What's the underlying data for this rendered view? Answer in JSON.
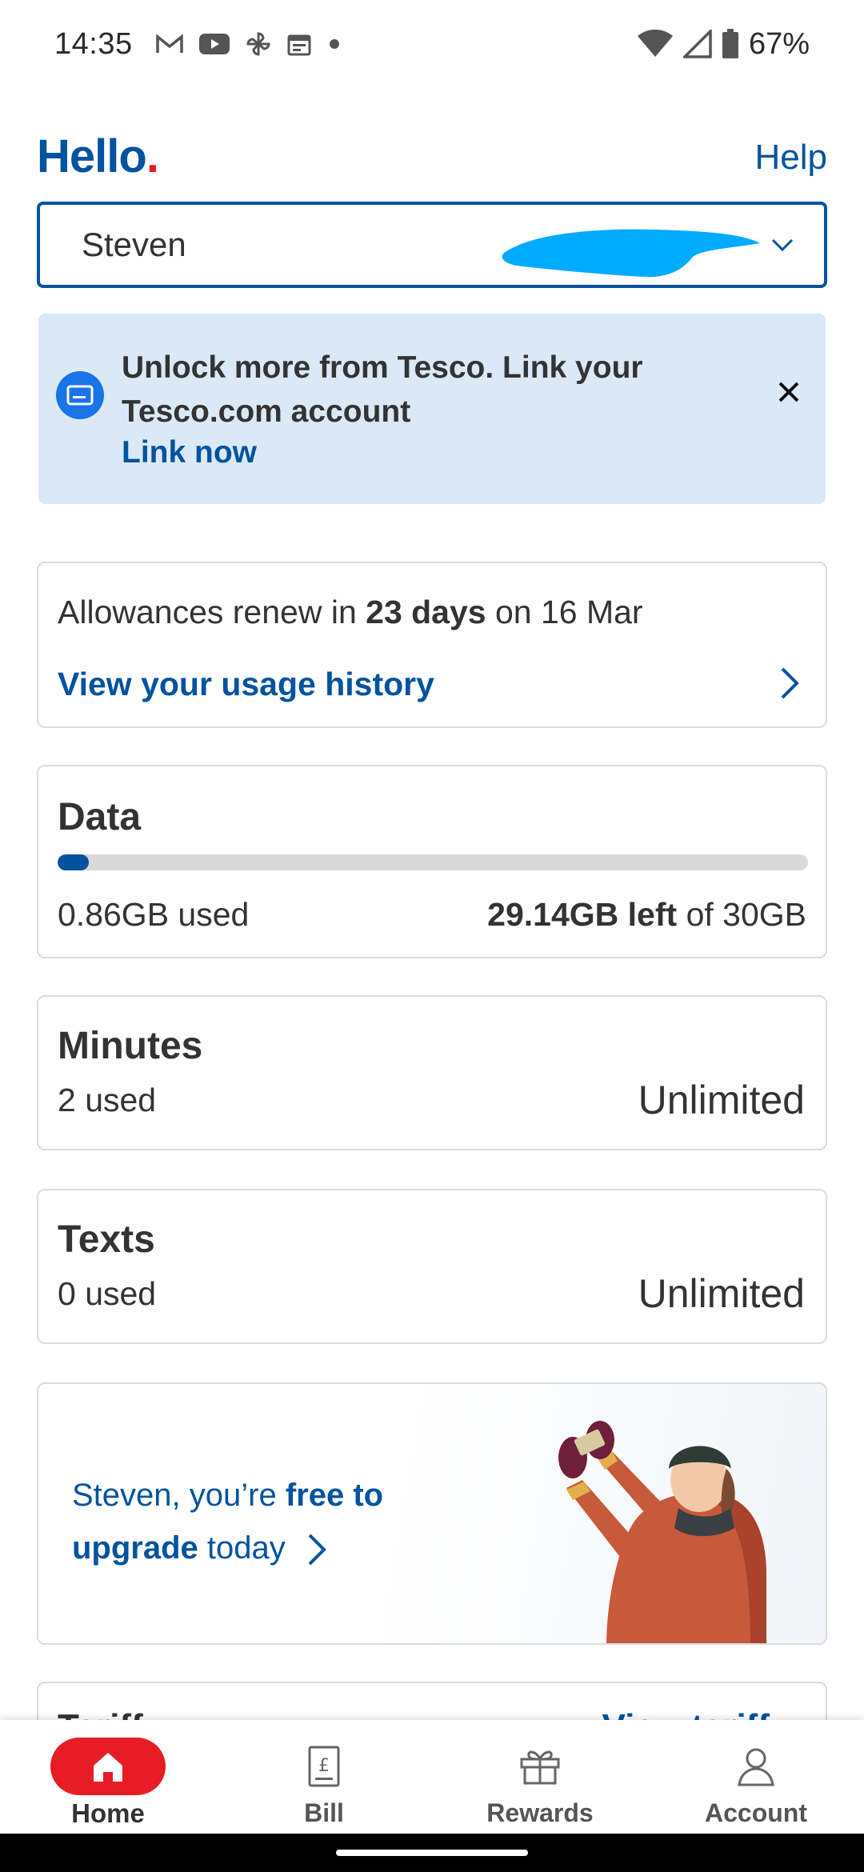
{
  "status_bar": {
    "time": "14:35",
    "battery": "67%",
    "icons": [
      "gmail-icon",
      "youtube-icon",
      "pinwheel-icon",
      "calendar-icon",
      "dot-icon",
      "wifi-icon",
      "signal-icon",
      "battery-icon"
    ]
  },
  "header": {
    "greeting": "Hello",
    "greeting_dot": ".",
    "help": "Help"
  },
  "account_select": {
    "name": "Steven",
    "icon": "chevron-down-icon"
  },
  "banner": {
    "text": "Unlock more from Tesco. Link your Tesco.com account",
    "link": "Link now",
    "icons": [
      "card-icon",
      "close-icon"
    ]
  },
  "renew": {
    "prefix": "Allowances renew in ",
    "days": "23 days",
    "suffix": " on 16 Mar",
    "usage_link": "View your usage history"
  },
  "data": {
    "title": "Data",
    "used": "0.86GB used",
    "left_value": "29.14GB left",
    "left_suffix": " of 30GB",
    "used_fraction": 0.0287
  },
  "minutes": {
    "title": "Minutes",
    "used": "2 used",
    "allowance": "Unlimited"
  },
  "texts": {
    "title": "Texts",
    "used": "0 used",
    "allowance": "Unlimited"
  },
  "promo": {
    "prefix": "Steven, you’re ",
    "bold": "free to upgrade",
    "suffix": " today"
  },
  "tariff": {
    "title": "Tariff",
    "link": "View tariff"
  },
  "bottom_nav": {
    "items": [
      {
        "label": "Home",
        "icon": "home-icon",
        "active": true
      },
      {
        "label": "Bill",
        "icon": "bill-icon",
        "active": false
      },
      {
        "label": "Rewards",
        "icon": "gift-icon",
        "active": false
      },
      {
        "label": "Account",
        "icon": "person-icon",
        "active": false
      }
    ]
  },
  "colors": {
    "brand_blue": "#00539f",
    "brand_red": "#e81c24",
    "banner_bg": "#dbe8f6",
    "redaction": "#00aaff"
  }
}
